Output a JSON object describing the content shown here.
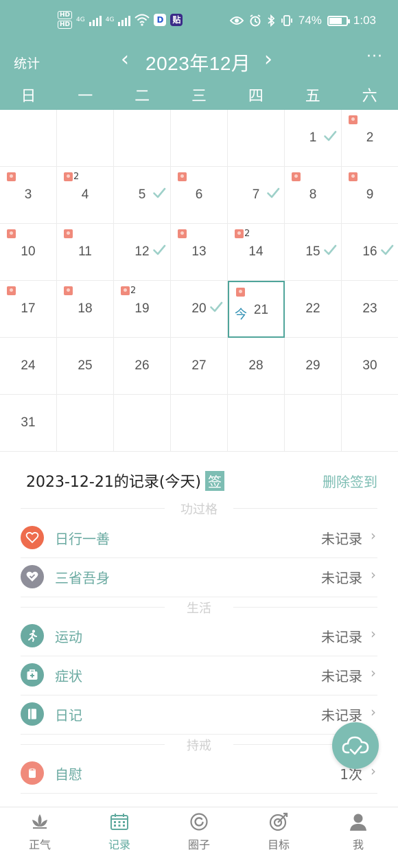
{
  "status_bar": {
    "hd1": "HD",
    "hd2": "HD",
    "net1": "4G",
    "net2": "4G",
    "app1": "D",
    "app2": "贴",
    "battery": "74%",
    "time": "1:03",
    "battery_level": 0.74
  },
  "header": {
    "stats_label": "统计",
    "prev": "‹",
    "title": "2023年12月",
    "next": "›",
    "more": "···"
  },
  "weekdays": [
    "日",
    "一",
    "二",
    "三",
    "四",
    "五",
    "六"
  ],
  "calendar": {
    "days": [
      {
        "day": "1",
        "weekday": 5,
        "week": 0,
        "roll": false,
        "count": "",
        "check": true
      },
      {
        "day": "2",
        "weekday": 6,
        "week": 0,
        "roll": true,
        "count": "",
        "check": false
      },
      {
        "day": "3",
        "weekday": 0,
        "week": 1,
        "roll": true,
        "count": "",
        "check": false
      },
      {
        "day": "4",
        "weekday": 1,
        "week": 1,
        "roll": true,
        "count": "2",
        "check": false
      },
      {
        "day": "5",
        "weekday": 2,
        "week": 1,
        "roll": false,
        "count": "",
        "check": true
      },
      {
        "day": "6",
        "weekday": 3,
        "week": 1,
        "roll": true,
        "count": "",
        "check": false
      },
      {
        "day": "7",
        "weekday": 4,
        "week": 1,
        "roll": false,
        "count": "",
        "check": true
      },
      {
        "day": "8",
        "weekday": 5,
        "week": 1,
        "roll": true,
        "count": "",
        "check": false
      },
      {
        "day": "9",
        "weekday": 6,
        "week": 1,
        "roll": true,
        "count": "",
        "check": false
      },
      {
        "day": "10",
        "weekday": 0,
        "week": 2,
        "roll": true,
        "count": "",
        "check": false
      },
      {
        "day": "11",
        "weekday": 1,
        "week": 2,
        "roll": true,
        "count": "",
        "check": false
      },
      {
        "day": "12",
        "weekday": 2,
        "week": 2,
        "roll": false,
        "count": "",
        "check": true
      },
      {
        "day": "13",
        "weekday": 3,
        "week": 2,
        "roll": true,
        "count": "",
        "check": false
      },
      {
        "day": "14",
        "weekday": 4,
        "week": 2,
        "roll": true,
        "count": "2",
        "check": false
      },
      {
        "day": "15",
        "weekday": 5,
        "week": 2,
        "roll": false,
        "count": "",
        "check": true
      },
      {
        "day": "16",
        "weekday": 6,
        "week": 2,
        "roll": false,
        "count": "",
        "check": true
      },
      {
        "day": "17",
        "weekday": 0,
        "week": 3,
        "roll": true,
        "count": "",
        "check": false
      },
      {
        "day": "18",
        "weekday": 1,
        "week": 3,
        "roll": true,
        "count": "",
        "check": false
      },
      {
        "day": "19",
        "weekday": 2,
        "week": 3,
        "roll": true,
        "count": "2",
        "check": false
      },
      {
        "day": "20",
        "weekday": 3,
        "week": 3,
        "roll": false,
        "count": "",
        "check": true
      },
      {
        "day": "21",
        "weekday": 4,
        "week": 3,
        "roll": true,
        "count": "",
        "check": false,
        "today": true,
        "today_label": "今"
      },
      {
        "day": "22",
        "weekday": 5,
        "week": 3,
        "roll": false,
        "count": "",
        "check": false
      },
      {
        "day": "23",
        "weekday": 6,
        "week": 3,
        "roll": false,
        "count": "",
        "check": false
      },
      {
        "day": "24",
        "weekday": 0,
        "week": 4,
        "roll": false,
        "count": "",
        "check": false
      },
      {
        "day": "25",
        "weekday": 1,
        "week": 4,
        "roll": false,
        "count": "",
        "check": false
      },
      {
        "day": "26",
        "weekday": 2,
        "week": 4,
        "roll": false,
        "count": "",
        "check": false
      },
      {
        "day": "27",
        "weekday": 3,
        "week": 4,
        "roll": false,
        "count": "",
        "check": false
      },
      {
        "day": "28",
        "weekday": 4,
        "week": 4,
        "roll": false,
        "count": "",
        "check": false
      },
      {
        "day": "29",
        "weekday": 5,
        "week": 4,
        "roll": false,
        "count": "",
        "check": false
      },
      {
        "day": "30",
        "weekday": 6,
        "week": 4,
        "roll": false,
        "count": "",
        "check": false
      },
      {
        "day": "31",
        "weekday": 0,
        "week": 5,
        "roll": false,
        "count": "",
        "check": false
      }
    ]
  },
  "records": {
    "title": "2023-12-21的记录(今天)",
    "sign_badge": "签",
    "delete_sign": "删除签到",
    "sections": [
      {
        "label": "功过格"
      },
      {
        "label": "生活"
      },
      {
        "label": "持戒"
      }
    ],
    "items": [
      {
        "name": "日行一善",
        "value": "未记录",
        "icon": "heart-icon",
        "color": "#ee6c4d"
      },
      {
        "name": "三省吾身",
        "value": "未记录",
        "icon": "heart-check-icon",
        "color": "#8e8e99"
      },
      {
        "name": "运动",
        "value": "未记录",
        "icon": "running-icon",
        "color": "#6aaaa1"
      },
      {
        "name": "症状",
        "value": "未记录",
        "icon": "medkit-icon",
        "color": "#6aaaa1"
      },
      {
        "name": "日记",
        "value": "未记录",
        "icon": "notebook-icon",
        "color": "#6aaaa1"
      },
      {
        "name": "自慰",
        "value": "1次",
        "icon": "roll-icon",
        "color": "#f08a7b"
      }
    ]
  },
  "fab": {
    "icon": "cloud-sync-icon"
  },
  "tabbar": {
    "tabs": [
      {
        "label": "正气",
        "icon": "lotus-icon",
        "active": false
      },
      {
        "label": "记录",
        "icon": "calendar-icon",
        "active": true
      },
      {
        "label": "圈子",
        "icon": "circle-icon",
        "active": false
      },
      {
        "label": "目标",
        "icon": "target-icon",
        "active": false
      },
      {
        "label": "我",
        "icon": "person-icon",
        "active": false
      }
    ]
  },
  "colors": {
    "accent": "#7dbdb3",
    "accent_text": "#6aaaa1",
    "roll": "#f08a7b",
    "today_tag": "#2f8fb3"
  }
}
